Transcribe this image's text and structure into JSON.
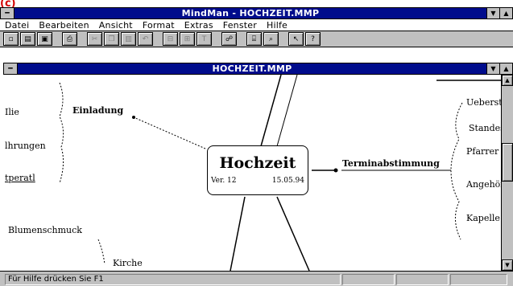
{
  "annotation_label": "(c)",
  "app": {
    "title": "MindMan - HOCHZEIT.MMP",
    "menu": [
      "Datei",
      "Bearbeiten",
      "Ansicht",
      "Format",
      "Extras",
      "Fenster",
      "Hilfe"
    ]
  },
  "toolbar": {
    "buttons": [
      {
        "icon": "new-document-icon",
        "glyph": "▫"
      },
      {
        "icon": "open-file-icon",
        "glyph": "▤"
      },
      {
        "icon": "save-icon",
        "glyph": "▣"
      },
      {
        "icon": "print-icon",
        "glyph": "⎙"
      },
      {
        "icon": "cut-icon",
        "glyph": "✂"
      },
      {
        "icon": "copy-icon",
        "glyph": "❐"
      },
      {
        "icon": "paste-icon",
        "glyph": "▥"
      },
      {
        "icon": "undo-icon",
        "glyph": "↶"
      },
      {
        "icon": "insert-branch-icon",
        "glyph": "⊟"
      },
      {
        "icon": "insert-subbranch-icon",
        "glyph": "⊞"
      },
      {
        "icon": "text-icon",
        "glyph": "T"
      },
      {
        "icon": "map-icon",
        "glyph": "☍"
      },
      {
        "icon": "print-preview-icon",
        "glyph": "⌸"
      },
      {
        "icon": "zoom-icon",
        "glyph": "⌕"
      },
      {
        "icon": "context-help-icon",
        "glyph": "↖"
      },
      {
        "icon": "help-icon",
        "glyph": "?"
      }
    ]
  },
  "document": {
    "title": "HOCHZEIT.MMP"
  },
  "mindmap": {
    "center": {
      "title": "Hochzeit",
      "version": "Ver. 12",
      "date": "15.05.94"
    },
    "left_branches": [
      "Einladung",
      "Blumenschmuck",
      "Kirche"
    ],
    "left_edge_labels": [
      "Ilie",
      "lhrungen",
      "tperatl"
    ],
    "right_branch": "Terminabstimmung",
    "right_sub": [
      "Ueberst",
      "Standes",
      "Pfarrer",
      "Angehöri",
      "Kapelle"
    ]
  },
  "status": {
    "text": "Für Hilfe drücken Sie F1"
  }
}
